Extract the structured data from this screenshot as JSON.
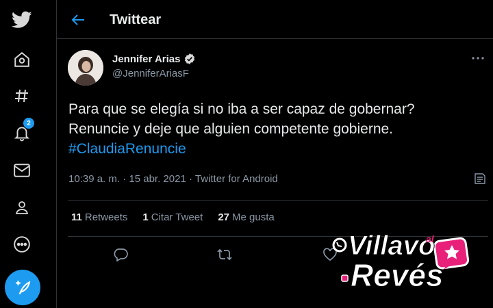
{
  "header": {
    "title": "Twittear"
  },
  "nav": {
    "notifications_badge": "2"
  },
  "tweet": {
    "author_name": "Jennifer Arias",
    "author_handle": "@JenniferAriasF",
    "text_lines": [
      "Para que se elegía si no iba a ser capaz de gobernar?",
      "Renuncie y deje que alguien competente gobierne."
    ],
    "hashtag": "#ClaudiaRenuncie",
    "time": "10:39 a. m.",
    "separator": "·",
    "date": "15 abr. 2021",
    "source": "Twitter for Android"
  },
  "stats": {
    "retweets_count": "11",
    "retweets_label": "Retweets",
    "quotes_count": "1",
    "quotes_label": "Citar Tweet",
    "likes_count": "27",
    "likes_label": "Me gusta"
  },
  "watermark": {
    "line1": "Villavo",
    "small": "al",
    "line2": "Revés"
  },
  "colors": {
    "accent": "#1d9bf0",
    "background": "#000000",
    "border": "#2f3336",
    "muted": "#8b98a5",
    "watermark_pink": "#e8207a"
  }
}
